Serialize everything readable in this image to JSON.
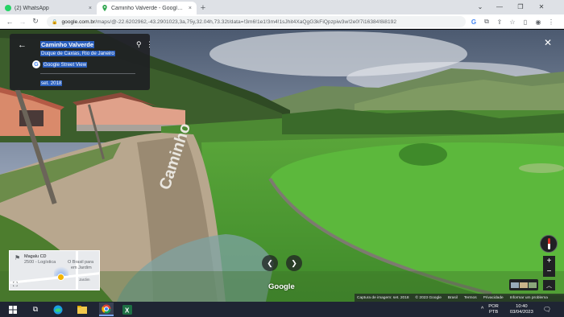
{
  "browser": {
    "tabs": [
      {
        "label": "(2) WhatsApp",
        "favicon": "whatsapp-icon",
        "color": "#25d366"
      },
      {
        "label": "Caminho Valverde - Google Maps",
        "favicon": "maps-pin-icon",
        "color": "#34a853"
      }
    ],
    "new_tab": "+",
    "close_tab": "×",
    "window_controls": {
      "chevron": "⌄",
      "minimize": "—",
      "maximize": "❐",
      "close": "✕"
    },
    "url_host": "google.com.br",
    "url_path": "/maps/@-22.6202962,-43.2901023,3a,75y,32.04h,73.32t/data=!3m6!1e1!3m4!1sJhit4XaQgG3kFiQpzpiw3w!2e0!7i16384!8i8192"
  },
  "street_view": {
    "place_name": "Caminho Valverde",
    "place_sub": "Duque de Caxias, Rio de Janeiro",
    "provider": "Google Street View",
    "capture_date": "set. 2018",
    "road_text": "Caminho",
    "logo": "Google",
    "nav_left": "❮",
    "nav_right": "❯",
    "close": "✕"
  },
  "minimap": {
    "labels": [
      "Magalu CD",
      "2500 - Logística",
      "O Brasil para",
      "em Jardim",
      "Jardim"
    ]
  },
  "controls": {
    "zoom_in": "+",
    "zoom_out": "−",
    "up": "︿"
  },
  "footer": [
    "Captura de imagem: set. 2018",
    "© 2023 Google",
    "Brasil",
    "Termos",
    "Privacidade",
    "Informar um problema"
  ],
  "taskbar": {
    "lang": "POR",
    "layout": "PTB",
    "time": "10:40",
    "date": "03/04/2023"
  },
  "colors": {
    "highlight": "#2a5fbd",
    "taskbar": "#1f2533",
    "chrome_tab_bg": "#dee1e6"
  }
}
